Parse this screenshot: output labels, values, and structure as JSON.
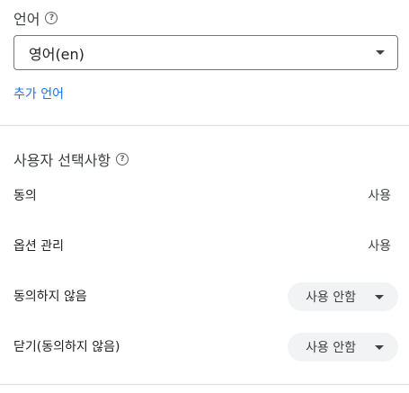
{
  "language_section": {
    "title": "언어",
    "selected_language": "영어(en)",
    "add_language_link": "추가 언어"
  },
  "preferences_section": {
    "title": "사용자 선택사항",
    "rows": [
      {
        "label": "동의",
        "value": "사용"
      },
      {
        "label": "옵션 관리",
        "value": "사용"
      },
      {
        "label": "동의하지 않음",
        "value": "사용 안함"
      },
      {
        "label": "닫기(동의하지 않음)",
        "value": "사용 안함"
      }
    ]
  },
  "colors": {
    "link": "#1a73e8",
    "pill_background": "#f1f3f4",
    "divider": "#dadce0"
  }
}
